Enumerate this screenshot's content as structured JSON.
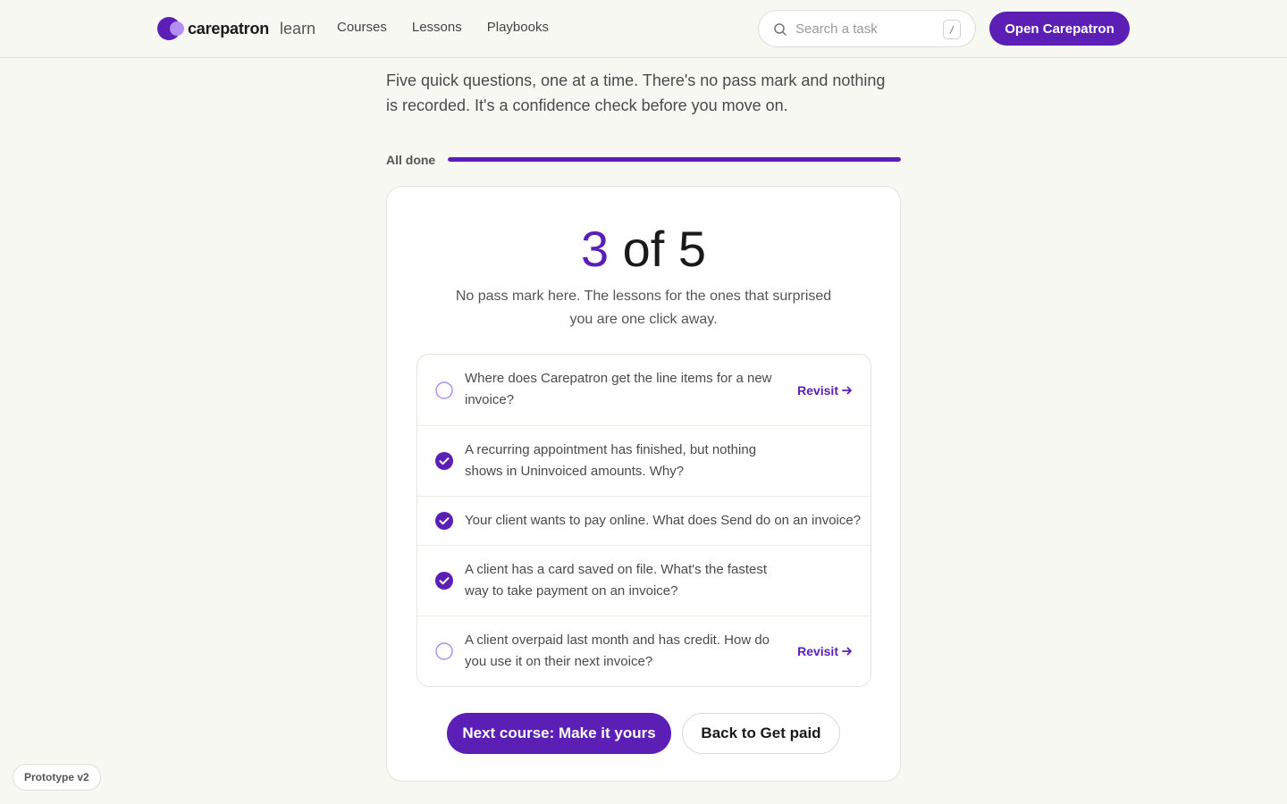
{
  "header": {
    "brand": "carepatron",
    "brand_sub": "learn",
    "nav": [
      "Courses",
      "Lessons",
      "Playbooks"
    ],
    "search_placeholder": "Search a task",
    "search_shortcut": "/",
    "cta": "Open Carepatron"
  },
  "intro": {
    "text": "Five quick questions, one at a time. There's no pass mark and nothing is recorded. It's a confidence check before you move on.",
    "progress_label": "All done",
    "progress_percent": 100
  },
  "result": {
    "score_correct": "3",
    "score_rest": " of 5",
    "note": "No pass mark here. The lessons for the ones that surprised you are one click away."
  },
  "questions": [
    {
      "text": "Where does Carepatron get the line items for a new invoice?",
      "correct": false,
      "action": "Revisit"
    },
    {
      "text": "A recurring appointment has finished, but nothing shows in Uninvoiced amounts. Why?",
      "correct": true,
      "action": ""
    },
    {
      "text": "Your client wants to pay online. What does Send do on an invoice?",
      "correct": true,
      "action": ""
    },
    {
      "text": "A client has a card saved on file. What's the fastest way to take payment on an invoice?",
      "correct": true,
      "action": ""
    },
    {
      "text": "A client overpaid last month and has credit. How do you use it on their next invoice?",
      "correct": false,
      "action": "Revisit"
    }
  ],
  "actions": {
    "next": "Next course: Make it yours",
    "back": "Back to Get paid"
  },
  "badge": "Prototype v2",
  "colors": {
    "accent": "#5b1fb5",
    "accent_light": "#b48ef0",
    "background": "#f8f8f3"
  }
}
